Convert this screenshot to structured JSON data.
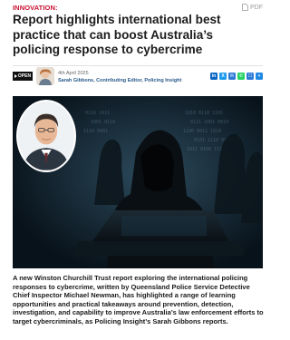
{
  "header": {
    "category": "INNOVATION:",
    "pdf_label": "PDF"
  },
  "article": {
    "headline": "Report highlights international best practice that can boost Australia’s policing response to cybercrime",
    "badge": "OPEN",
    "date": "4th April 2025",
    "author": "Sarah Gibbons, Contributing Editor, Policing Insight",
    "lede": "A new Winston Churchill Trust report exploring the international policing responses to cybercrime, written by Queensland Police Service Detective Chief Inspector Michael Newman, has highlighted a range of learning opportunities and practical takeaways around prevention, detection, investigation, and capability to improve Australia’s law enforcement efforts to target cybercriminals, as Policing Insight’s Sarah Gibbons reports."
  },
  "share": [
    {
      "name": "linkedin",
      "glyph": "in",
      "color": "#0a66c2"
    },
    {
      "name": "x",
      "glyph": "X",
      "color": "#1d9bf0"
    },
    {
      "name": "email",
      "glyph": "✉",
      "color": "#2d7ad6"
    },
    {
      "name": "whatsapp",
      "glyph": "✆",
      "color": "#25d366"
    },
    {
      "name": "sms",
      "glyph": "☐",
      "color": "#2d7ad6"
    },
    {
      "name": "more",
      "glyph": "+",
      "color": "#1e88e5"
    }
  ],
  "colors": {
    "category_red": "#c8102e",
    "author_blue": "#2a5a8a"
  }
}
